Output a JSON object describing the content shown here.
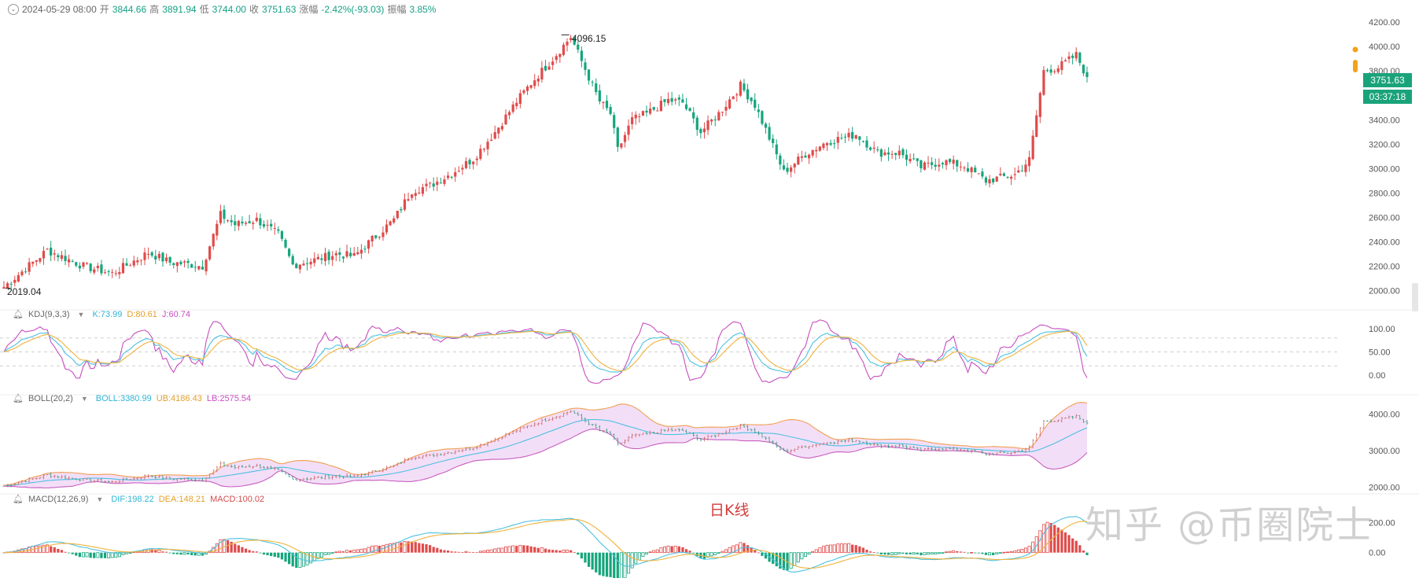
{
  "header": {
    "date": "2024-05-29 08:00",
    "open_label": "开",
    "open": "3844.66",
    "high_label": "高",
    "high": "3891.94",
    "low_label": "低",
    "low": "3744.00",
    "close_label": "收",
    "close": "3751.63",
    "change_label": "涨幅",
    "change": "-2.42%(-93.03)",
    "amp_label": "振幅",
    "amplitude": "3.85%"
  },
  "price_tags": {
    "last_price": "3751.63",
    "countdown": "03:37:18"
  },
  "annotations": {
    "high_mark": "4096.15",
    "low_mark": "2019.04"
  },
  "colors": {
    "up": "#e04b4b",
    "down": "#16a57c",
    "k_line": "#4cc1e0",
    "d_line": "#f0b23c",
    "j_line": "#c74fbf",
    "boll_mid": "#4cc1e0",
    "boll_band": "#f0a050",
    "boll_fill": "#f1d8f7",
    "accent": "#1aa37a"
  },
  "kdj": {
    "title": "KDJ(9,3,3)",
    "k": "K:73.99",
    "d": "D:80.61",
    "j": "J:60.74"
  },
  "boll": {
    "title": "BOLL(20,2)",
    "mid": "BOLL:3380.99",
    "ub": "UB:4186.43",
    "lb": "LB:2575.54"
  },
  "macd": {
    "title": "MACD(12,26,9)",
    "dif": "DIF:198.22",
    "dea": "DEA:148.21",
    "macd": "MACD:100.02"
  },
  "day_label": "日K线",
  "watermark": "知乎 @币圈院士",
  "chart_data": [
    {
      "type": "candlestick",
      "title": "",
      "y_ticks": [
        "4200.00",
        "4000.00",
        "3800.00",
        "3600.00",
        "3400.00",
        "3200.00",
        "3000.00",
        "2800.00",
        "2600.00",
        "2400.00",
        "2200.00",
        "2000.00"
      ],
      "ylim": [
        1880,
        4240
      ],
      "close_anchors": [
        [
          0,
          2030
        ],
        [
          12,
          2330
        ],
        [
          22,
          2200
        ],
        [
          30,
          2140
        ],
        [
          40,
          2310
        ],
        [
          46,
          2230
        ],
        [
          50,
          2220
        ],
        [
          55,
          2200
        ],
        [
          60,
          2620
        ],
        [
          64,
          2540
        ],
        [
          70,
          2580
        ],
        [
          76,
          2460
        ],
        [
          80,
          2210
        ],
        [
          86,
          2250
        ],
        [
          92,
          2300
        ],
        [
          97,
          2280
        ],
        [
          102,
          2420
        ],
        [
          108,
          2580
        ],
        [
          113,
          2820
        ],
        [
          118,
          2860
        ],
        [
          124,
          2960
        ],
        [
          130,
          3080
        ],
        [
          136,
          3300
        ],
        [
          142,
          3550
        ],
        [
          146,
          3700
        ],
        [
          152,
          3900
        ],
        [
          157,
          4080
        ],
        [
          160,
          3880
        ],
        [
          165,
          3550
        ],
        [
          168,
          3450
        ],
        [
          170,
          3150
        ],
        [
          174,
          3400
        ],
        [
          178,
          3450
        ],
        [
          184,
          3560
        ],
        [
          188,
          3540
        ],
        [
          193,
          3300
        ],
        [
          198,
          3450
        ],
        [
          204,
          3680
        ],
        [
          208,
          3520
        ],
        [
          212,
          3250
        ],
        [
          216,
          2970
        ],
        [
          222,
          3120
        ],
        [
          228,
          3220
        ],
        [
          236,
          3280
        ],
        [
          242,
          3130
        ],
        [
          248,
          3130
        ],
        [
          254,
          3010
        ],
        [
          260,
          3060
        ],
        [
          266,
          3020
        ],
        [
          272,
          2900
        ],
        [
          280,
          2950
        ],
        [
          284,
          3070
        ],
        [
          288,
          3800
        ],
        [
          292,
          3830
        ],
        [
          297,
          3930
        ],
        [
          300,
          3750
        ]
      ],
      "high_point": {
        "index": 157,
        "value": 4096.15
      },
      "low_point": {
        "index": 0,
        "value": 2019.04
      },
      "candle_count": 301
    },
    {
      "type": "line",
      "title": "KDJ(9,3,3)",
      "series": [
        {
          "name": "K",
          "value": 73.99
        },
        {
          "name": "D",
          "value": 80.61
        },
        {
          "name": "J",
          "value": 60.74
        }
      ],
      "y_ticks": [
        "100.00",
        "50.00",
        "0.00"
      ],
      "ylim": [
        -30,
        130
      ],
      "reference_levels": [
        80,
        50,
        20
      ]
    },
    {
      "type": "line",
      "title": "BOLL(20,2)",
      "series": [
        {
          "name": "BOLL",
          "value": 3380.99
        },
        {
          "name": "UB",
          "value": 4186.43
        },
        {
          "name": "LB",
          "value": 2575.54
        }
      ],
      "y_ticks": [
        "4000.00",
        "3000.00",
        "2000.00"
      ],
      "ylim": [
        1880,
        4350
      ]
    },
    {
      "type": "bar",
      "title": "MACD(12,26,9)",
      "series": [
        {
          "name": "DIF",
          "value": 198.22
        },
        {
          "name": "DEA",
          "value": 148.21
        },
        {
          "name": "MACD",
          "value": 100.02
        }
      ],
      "y_ticks": [
        "200.00",
        "0.00"
      ],
      "ylim": [
        -170,
        330
      ]
    }
  ]
}
